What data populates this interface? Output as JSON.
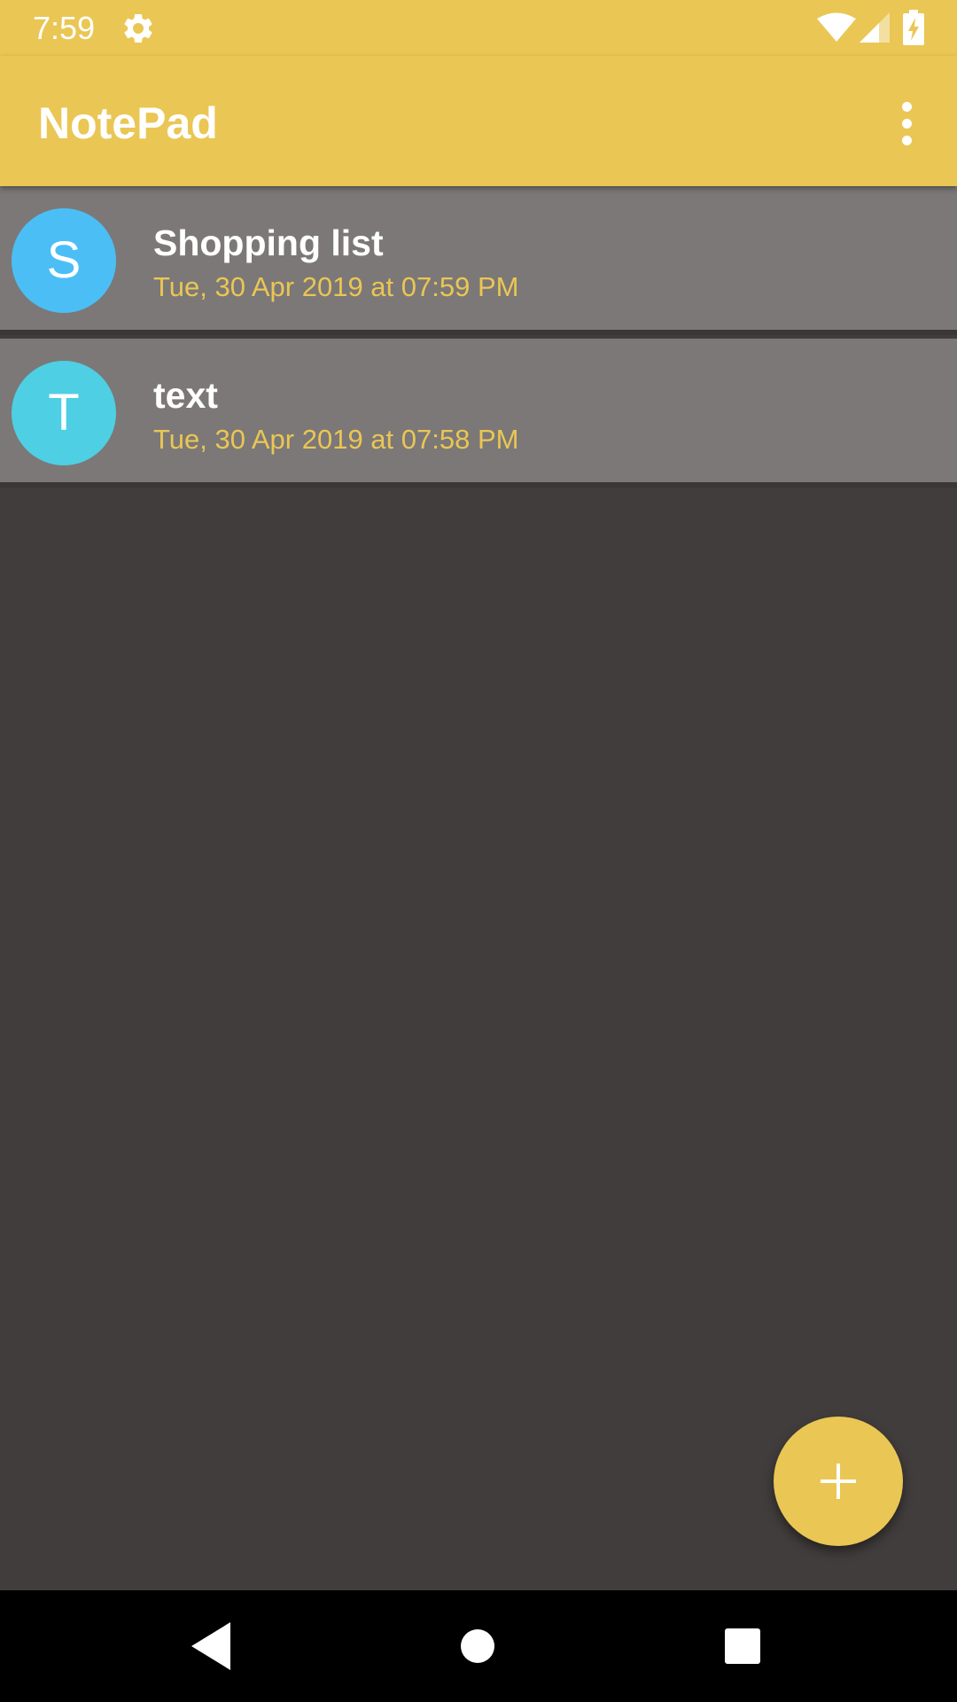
{
  "status_bar": {
    "time": "7:59",
    "icons": [
      "gear-icon",
      "wifi-icon",
      "signal-icon",
      "battery-charging-icon"
    ]
  },
  "toolbar": {
    "title": "NotePad",
    "menu_icon": "more-vert-icon"
  },
  "notes": [
    {
      "initial": "S",
      "title": "Shopping list",
      "date": "Tue, 30 Apr 2019 at 07:59 PM",
      "avatar_color": "#4bbff5"
    },
    {
      "initial": "T",
      "title": "text",
      "date": "Tue, 30 Apr 2019 at 07:58 PM",
      "avatar_color": "#4ecfe3"
    }
  ],
  "fab": {
    "icon": "plus-icon"
  },
  "nav_bar": {
    "icons": [
      "back-icon",
      "home-icon",
      "recents-icon"
    ]
  },
  "colors": {
    "accent": "#eac654",
    "list_item_bg": "#7c7877",
    "background": "#413d3c"
  }
}
